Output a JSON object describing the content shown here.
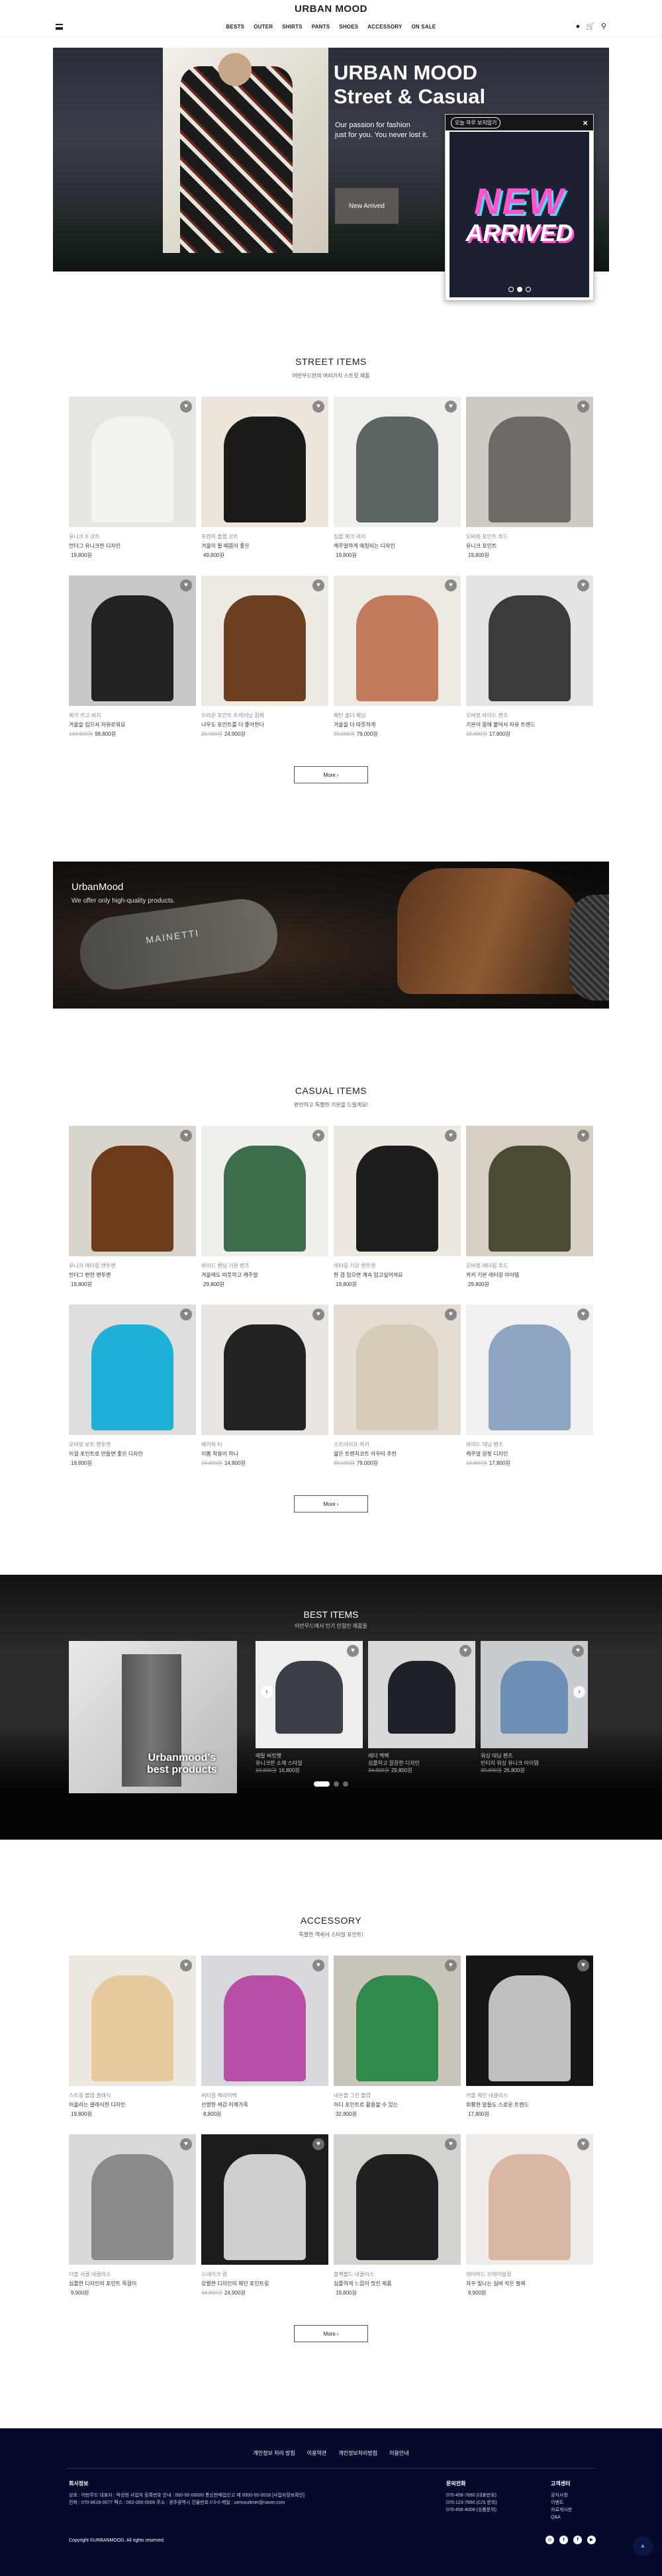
{
  "header": {
    "logo": "URBAN MOOD",
    "nav": [
      "BESTS",
      "OUTER",
      "SHIRTS",
      "PANTS",
      "SHOES",
      "ACCESSORY",
      "ON SALE"
    ],
    "icons": [
      "user-icon",
      "cart-icon",
      "search-icon"
    ]
  },
  "hero": {
    "title_line1": "URBAN MOOD",
    "title_line2": "Street & Casual",
    "sub_line1": "Our passion for fashion",
    "sub_line2": "just for you. You never lost it.",
    "button": "New Arrived"
  },
  "popup": {
    "close_today": "오늘 하루 보지않기",
    "close": "×",
    "headline1": "NEW",
    "headline2": "ARRIVED",
    "dots": 3,
    "active_dot": 2
  },
  "street": {
    "title": "STREET ITEMS",
    "sub": "어반무드만의 여러가지 스트릿 제품",
    "more": "More  ›",
    "items": [
      {
        "cat": "유니크 X 코트",
        "name": "언더그 유니크한 디자인",
        "price": "19,800원",
        "old": "",
        "bg": "#e7e6e2",
        "fg": "#f4f3ef"
      },
      {
        "cat": "프렌치 플랩 코트",
        "name": "겨울이 될 때쯤이 좋은",
        "price": "49,800원",
        "old": "",
        "bg": "#ece6dd",
        "fg": "#1d1b1a"
      },
      {
        "cat": "심플 체크 바지",
        "name": "캐주얼하게 매칭되는 디자인",
        "price": "19,800원",
        "old": "",
        "bg": "#f0efec",
        "fg": "#5b6561"
      },
      {
        "cat": "오버핏 포인트 후드",
        "name": "유니크 포인트",
        "price": "19,800원",
        "old": "",
        "bg": "#cfcac4",
        "fg": "#6e6a66"
      },
      {
        "cat": "체크 카고 바지",
        "name": "겨울을 입으셔 자유로워요",
        "price": "98,800원",
        "old": "149,800원",
        "bg": "#c9c8c6",
        "fg": "#222222"
      },
      {
        "cat": "브라운 포인트 트레이닝 점퍼",
        "name": "너무도 포인트를 더 좋아한다",
        "price": "24,900원",
        "old": "29,900원",
        "bg": "#eeeae4",
        "fg": "#6b3f20"
      },
      {
        "cat": "패턴 숄더 패딩",
        "name": "겨울을 더 따뜻하게",
        "price": "79,000원",
        "old": "89,000원",
        "bg": "#ede9e3",
        "fg": "#c27a5c"
      },
      {
        "cat": "오버핏 와이드 팬츠",
        "name": "기본이 몸에 붙어서 자유 트렌드",
        "price": "17,800원",
        "old": "19,800원",
        "bg": "#e4e4e4",
        "fg": "#3b3b3b"
      }
    ]
  },
  "banner": {
    "title": "UrbanMood",
    "sub": "We offer only high-quality products.",
    "brand": "MAINETTI"
  },
  "casual": {
    "title": "CASUAL ITEMS",
    "sub": "편안하고 특별한 기분을 드릴게요!",
    "more": "More  ›",
    "items": [
      {
        "cat": "유니크 레터링 맨투맨",
        "name": "언더그 편한 맨투맨",
        "price": "19,800원",
        "old": "",
        "bg": "#d9d4cc",
        "fg": "#6e3a1c"
      },
      {
        "cat": "와이드 밴딩 기본 팬츠",
        "name": "겨울에도 따뜻하고 캐주얼",
        "price": "29,800원",
        "old": "",
        "bg": "#f1efe9",
        "fg": "#3d6e4c"
      },
      {
        "cat": "레터링 기모 맨투맨",
        "name": "한 겹 입으면 계속 입고싶어져요",
        "price": "19,800원",
        "old": "",
        "bg": "#ede9e1",
        "fg": "#1e1d1c"
      },
      {
        "cat": "오버핏 레터링 후드",
        "name": "카키 기본 레터링 아이템",
        "price": "29,800원",
        "old": "",
        "bg": "#d6d0c4",
        "fg": "#4c4a33"
      },
      {
        "cat": "오버핏 보트 맨투맨",
        "name": "이걸 포인트로 만들면 좋은 디자인",
        "price": "19,800원",
        "old": "",
        "bg": "#dedede",
        "fg": "#1fb0d8"
      },
      {
        "cat": "베이직 티",
        "name": "이쁨 착용이 하나",
        "price": "14,800원",
        "old": "24,800원",
        "bg": "#e8e5e0",
        "fg": "#222222"
      },
      {
        "cat": "스트라이프 카키",
        "name": "얇은 트렌치코트 아우터 추천",
        "price": "79,000원",
        "old": "89,000원",
        "bg": "#e3ddd3",
        "fg": "#d4cbb9"
      },
      {
        "cat": "와이드 데님 팬츠",
        "name": "캐주얼 원핏 디자인",
        "price": "17,800원",
        "old": "19,800원",
        "bg": "#f0f0f0",
        "fg": "#8da4c2"
      }
    ]
  },
  "best": {
    "title": "BEST ITEMS",
    "sub": "어반무드에서 인기 만점인 제품들",
    "feature_line1": "Urbanmood's",
    "feature_line2": "best products",
    "slides": [
      {
        "cat": "메탈 버킷햇",
        "name": "유니크한 소재 스타일",
        "price": "16,800원",
        "old": "19,800원",
        "bg": "#eeeeee",
        "fg": "#3b3f46"
      },
      {
        "cat": "레더 백팩",
        "name": "심플하고 깔끔한 디자인",
        "price": "29,800원",
        "old": "34,800원",
        "bg": "#d9d9d9",
        "fg": "#1e2128"
      },
      {
        "cat": "워싱 데님 팬츠",
        "name": "빈티지 워싱 유니크 아이템",
        "price": "26,800원",
        "old": "39,800원",
        "bg": "#c8ccd0",
        "fg": "#6d8fb3"
      }
    ],
    "prev": "‹",
    "next": "›",
    "dots": 3,
    "active_dot": 1
  },
  "accessory": {
    "title": "ACCESSORY",
    "sub": "특별한 액세서 스타일 포인트!",
    "more": "More  ›",
    "items": [
      {
        "cat": "스트링 볼캡 클래식",
        "name": "어울리는 클래식한 디자인",
        "price": "19,800원",
        "old": "",
        "bg": "#ece7df",
        "fg": "#e7c9a0"
      },
      {
        "cat": "버티컬 캐리어백",
        "name": "선명한 색감 어깨가죽",
        "price": "8,800원",
        "old": "",
        "bg": "#d8d9dc",
        "fg": "#b84ea6"
      },
      {
        "cat": "네온볼 그린 볼캡",
        "name": "어디 포인트로 활용할 수 있는",
        "price": "32,800원",
        "old": "",
        "bg": "#c9c4b9",
        "fg": "#2f8a4c"
      },
      {
        "cat": "커플 체인 네클리스",
        "name": "휘황한 알들도 스로운 트렌드",
        "price": "17,800원",
        "old": "",
        "bg": "#151515",
        "fg": "#bfbfbf"
      },
      {
        "cat": "더블 서클 네클리스",
        "name": "심플한 디자인의 포인트 목걸이",
        "price": "9,900원",
        "old": "",
        "bg": "#d9d9d9",
        "fg": "#8a8a8a"
      },
      {
        "cat": "스네이크 링",
        "name": "강렬한 디자인의 체인 포인트링",
        "price": "24,900원",
        "old": "34,800원",
        "bg": "#1c1c1c",
        "fg": "#cfcfcf"
      },
      {
        "cat": "블랙볼드 네클리스",
        "name": "심플하게 느낌이 멋진 제품",
        "price": "19,800원",
        "old": "",
        "bg": "#d4d2cf",
        "fg": "#202020"
      },
      {
        "cat": "레이어드 브레이슬릿",
        "name": "자꾸 빛나는 실버 작은 팔찌",
        "price": "9,900원",
        "old": "",
        "bg": "#efebe6",
        "fg": "#d8b8a5"
      }
    ]
  },
  "footer": {
    "links": [
      "개인정보 처리 방침",
      "이용약관",
      "개인정보처리방침",
      "이용안내"
    ],
    "company_title": "회사정보",
    "company_lines": [
      "상호 : 어반무드   대표자 : 박성현   사업자 등록번호 안내 : 000-00-00000   통신판매업신고 제 0000-00-0018   [사업자정보확인]",
      "전화 : 070-8618-0077   팩스 : 062-000-0000   주소 : 광주광역시 건물번호 0 0-0   메일 : uemoudmer@naver.com"
    ],
    "cs_title": "문의전화",
    "cs_lines": [
      "070-456-7890 (대표번호)",
      "070-123-7890 (C/S 문의)",
      "070-456-4008 (상품문의)"
    ],
    "center_title": "고객센터",
    "center_lines": [
      "공지사항",
      "이벤트",
      "자료게시판",
      "Q&A"
    ],
    "copyright": "Copyright ©URBANMOOD. All rights reserved.",
    "sns": [
      "instagram-icon",
      "twitter-icon",
      "facebook-icon",
      "youtube-icon"
    ],
    "top": "▲"
  }
}
